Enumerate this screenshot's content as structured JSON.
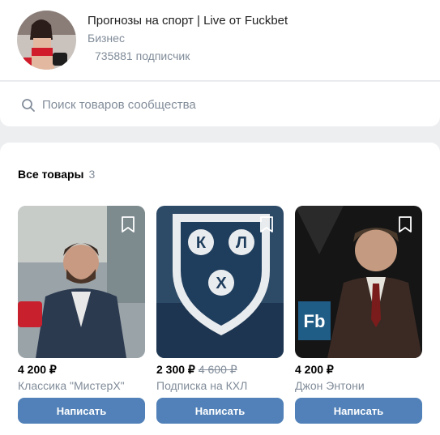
{
  "group": {
    "title": "Прогнозы на спорт | Live от Fuckbet",
    "type": "Бизнес",
    "subscribers": "735881 подписчик"
  },
  "search": {
    "placeholder": "Поиск товаров сообщества"
  },
  "goods": {
    "title": "Все товары",
    "count": "3",
    "items": [
      {
        "price": "4 200 ₽",
        "old_price": "",
        "name": "Классика \"МистерХ\"",
        "button": "Написать",
        "image": "man-in-cafe-photo"
      },
      {
        "price": "2 300 ₽",
        "old_price": "4 600 ₽",
        "name": "Подписка на КХЛ",
        "button": "Написать",
        "image": "khl-logo-photo"
      },
      {
        "price": "4 200 ₽",
        "old_price": "",
        "name": "Джон Энтони",
        "button": "Написать",
        "image": "man-in-suit-photo"
      }
    ]
  },
  "colors": {
    "accent": "#5181b8",
    "secondary_text": "#818c99",
    "background": "#edeef0"
  }
}
